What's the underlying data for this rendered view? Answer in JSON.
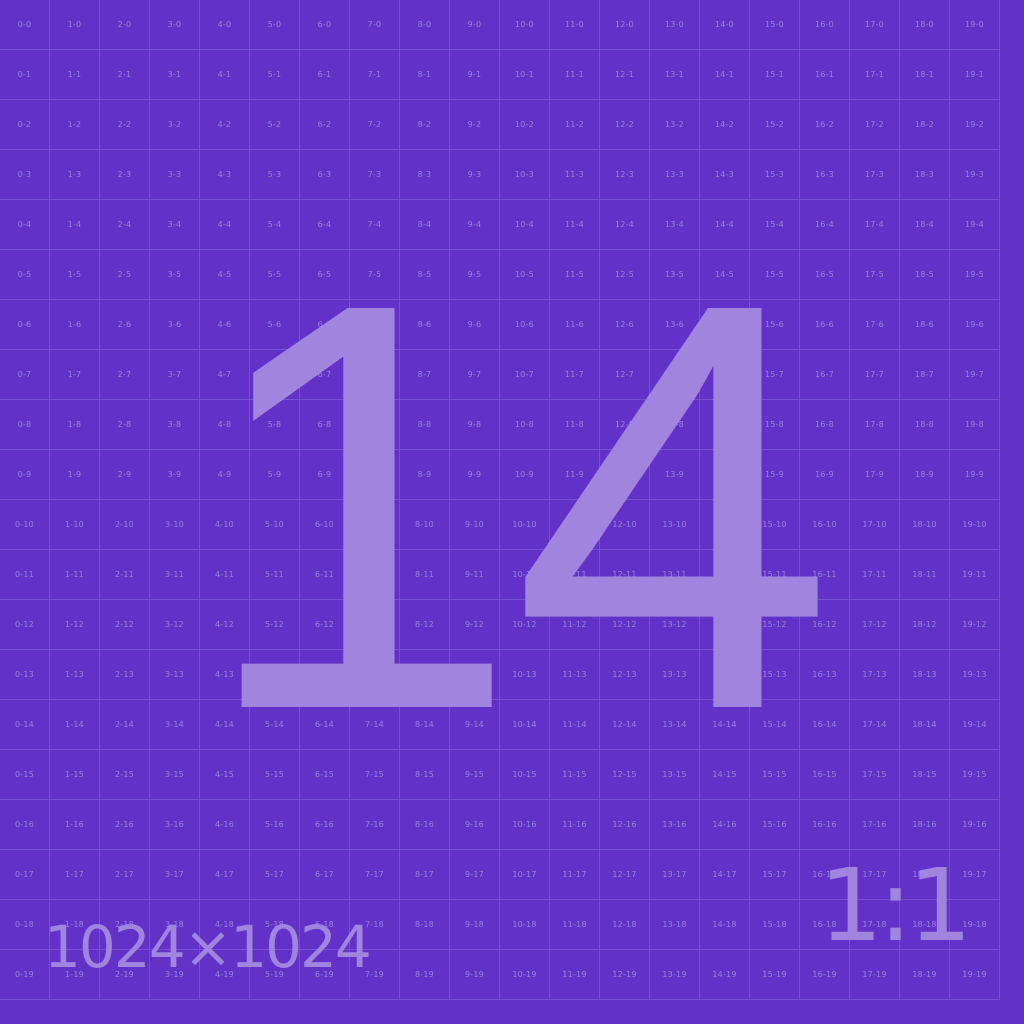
{
  "background_color": "#6232c8",
  "grid": {
    "columns": 20,
    "rows": 20,
    "line_color": "#7650d4",
    "label_color": "#9a80da",
    "label_format": "{col}-{row}"
  },
  "main_number": "14",
  "main_color": "#a084de",
  "dimensions_label": "1024×1024",
  "aspect_ratio_label": "1:1"
}
